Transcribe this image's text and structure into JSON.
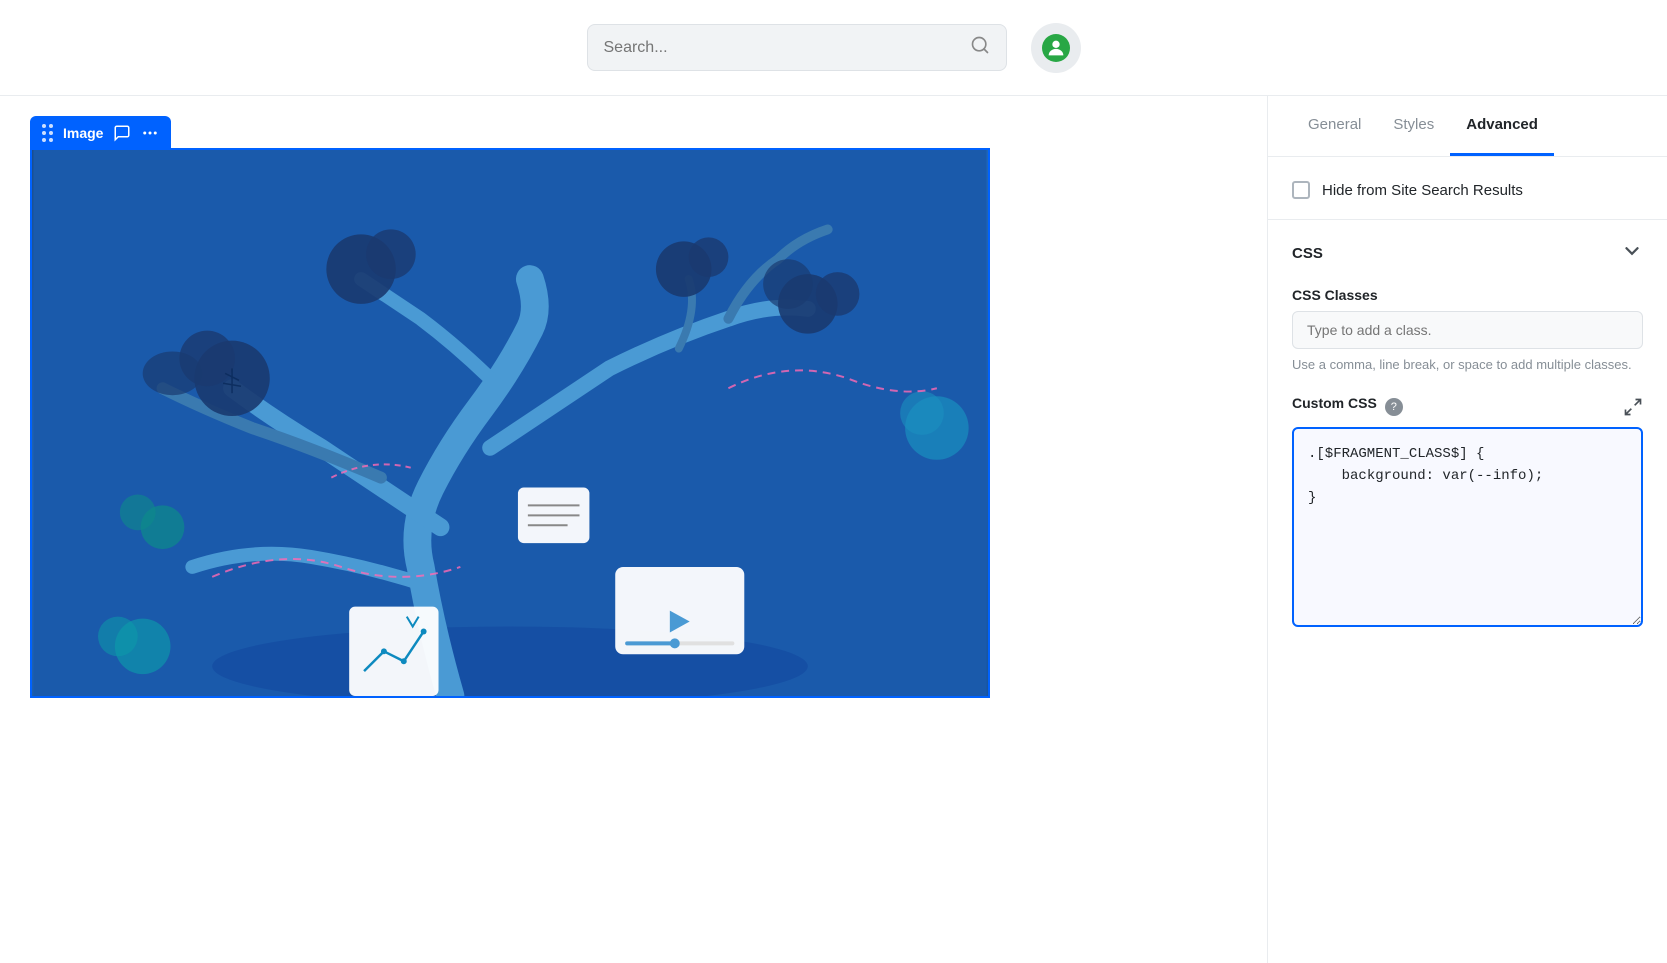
{
  "header": {
    "search_placeholder": "Search...",
    "avatar_label": "User avatar"
  },
  "panel": {
    "tabs": [
      {
        "id": "general",
        "label": "General",
        "active": false
      },
      {
        "id": "styles",
        "label": "Styles",
        "active": false
      },
      {
        "id": "advanced",
        "label": "Advanced",
        "active": true
      }
    ],
    "hide_from_search": {
      "label": "Hide from Site Search Results",
      "checked": false
    },
    "css_section": {
      "title": "CSS",
      "collapsed": false
    },
    "css_classes": {
      "label": "CSS Classes",
      "placeholder": "Type to add a class.",
      "helper": "Use a comma, line break, or space to add multiple classes."
    },
    "custom_css": {
      "label": "Custom CSS",
      "help_icon": "?",
      "value": ".[$FRAGMENT_CLASS$] {\n    background: var(--info);\n}"
    }
  },
  "widget": {
    "label": "Image",
    "drag_handle": "drag-dots",
    "comment_icon": "comment",
    "more_icon": "more"
  },
  "icons": {
    "search": "🔍",
    "user": "👤",
    "comment": "🗨",
    "more": "⋯",
    "chevron_down": "⌄",
    "expand": "⛶",
    "help": "?"
  }
}
